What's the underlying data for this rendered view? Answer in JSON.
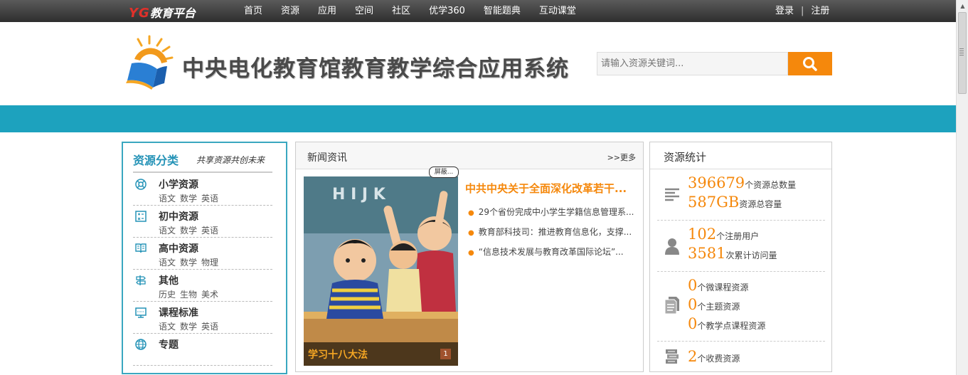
{
  "topbar": {
    "brand_prefix": "YG",
    "brand_suffix": "教育平台",
    "nav": [
      "首页",
      "资源",
      "应用",
      "空间",
      "社区",
      "优学360",
      "智能题典",
      "互动课堂"
    ],
    "login": "登录",
    "separator": "|",
    "register": "注册"
  },
  "header": {
    "title": "中央电化教育馆教育教学综合应用系统",
    "search_placeholder": "请输入资源关键词..."
  },
  "categories": {
    "title": "资源分类",
    "slogan": "共享资源共创未来",
    "items": [
      {
        "name": "小学资源",
        "subs": [
          "语文",
          "数学",
          "英语"
        ]
      },
      {
        "name": "初中资源",
        "subs": [
          "语文",
          "数学",
          "英语"
        ]
      },
      {
        "name": "高中资源",
        "subs": [
          "语文",
          "数学",
          "物理"
        ]
      },
      {
        "name": "其他",
        "subs": [
          "历史",
          "生物",
          "美术"
        ]
      },
      {
        "name": "课程标准",
        "subs": [
          "语文",
          "数学",
          "英语"
        ]
      },
      {
        "name": "专题",
        "subs": []
      }
    ]
  },
  "news": {
    "title": "新闻资讯",
    "more": ">>更多",
    "bubble": "屏蔽...",
    "photo_caption": "学习十八大法",
    "photo_index": "1",
    "headline": "中共中央关于全面深化改革若干...",
    "items": [
      "29个省份完成中小学生学籍信息管理系...",
      "教育部科技司：推进教育信息化，支撑...",
      "“信息技术发展与教育改革国际论坛”..."
    ]
  },
  "stats": {
    "title": "资源统计",
    "groups": [
      {
        "icon": "list-icon",
        "rows": [
          {
            "num": "396679",
            "label": "个资源总数量"
          },
          {
            "num": "587GB",
            "label": "资源总容量"
          }
        ]
      },
      {
        "icon": "user-icon",
        "rows": [
          {
            "num": "102",
            "label": "个注册用户"
          },
          {
            "num": "3581",
            "label": "次累计访问量"
          }
        ]
      },
      {
        "icon": "document-icon",
        "rows": [
          {
            "num": "0",
            "label": "个微课程资源"
          },
          {
            "num": "0",
            "label": "个主题资源"
          },
          {
            "num": "0",
            "label": "个教学点课程资源"
          }
        ]
      },
      {
        "icon": "books-icon",
        "rows": [
          {
            "num": "2",
            "label": "个收费资源"
          }
        ]
      }
    ]
  },
  "colors": {
    "accent": "#f5880c",
    "band": "#1da2be",
    "panel_border": "#3aa7c0"
  }
}
